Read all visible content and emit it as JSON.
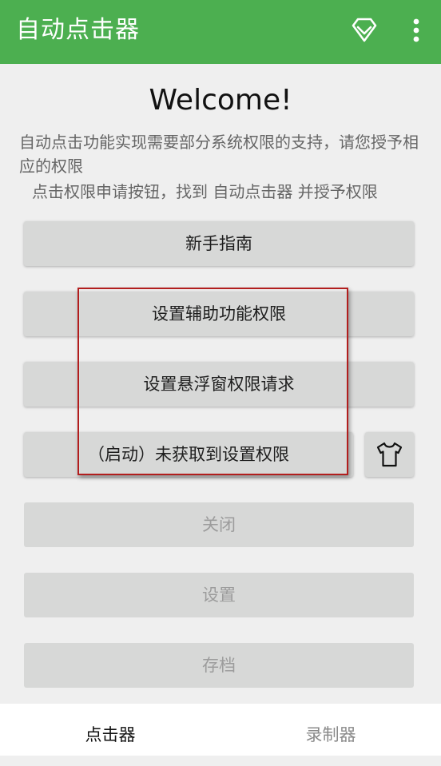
{
  "app_bar": {
    "title": "自动点击器",
    "icons": [
      "diamond-icon",
      "more-vertical-icon"
    ],
    "background_color": "#4caf50"
  },
  "main": {
    "welcome_title": "Welcome!",
    "description_line1": "自动点击功能实现需要部分系统权限的支持，请您授予相应的权限",
    "description_line2": "点击权限申请按钮，找到 自动点击器 并授予权限"
  },
  "buttons": {
    "guide": "新手指南",
    "accessibility_permission": "设置辅助功能权限",
    "overlay_permission": "设置悬浮窗权限请求",
    "start_status": "（启动）未获取到设置权限",
    "close": "关闭",
    "settings": "设置",
    "archive": "存档",
    "theme_icon": "tshirt-icon"
  },
  "bottom_nav": {
    "tabs": [
      {
        "label": "点击器",
        "active": true
      },
      {
        "label": "录制器",
        "active": false
      }
    ]
  },
  "highlight_color": "#b21e1e"
}
